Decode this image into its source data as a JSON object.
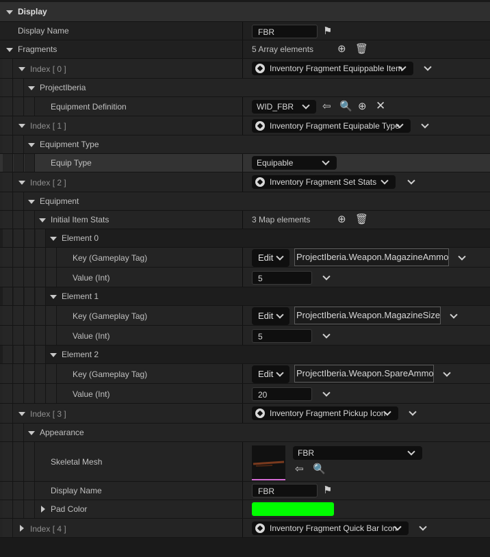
{
  "section": {
    "title": "Display"
  },
  "display_name": {
    "label": "Display Name",
    "value": "FBR"
  },
  "fragments": {
    "label": "Fragments",
    "count": "5 Array elements"
  },
  "index0": {
    "label": "Index [ 0 ]",
    "type": "Inventory Fragment Equippable Item",
    "category": "ProjectIberia",
    "equip_def_label": "Equipment Definition",
    "equip_def_value": "WID_FBR"
  },
  "index1": {
    "label": "Index [ 1 ]",
    "type": "Inventory Fragment Equipable Type",
    "category": "Equipment Type",
    "equip_type_label": "Equip Type",
    "equip_type_value": "Equipable"
  },
  "index2": {
    "label": "Index [ 2 ]",
    "type": "Inventory Fragment Set Stats",
    "category": "Equipment",
    "stats_label": "Initial Item Stats",
    "stats_count": "3 Map elements",
    "elements": [
      {
        "label": "Element 0",
        "key_label": "Key (Gameplay Tag)",
        "edit": "Edit",
        "tag": "ProjectIberia.Weapon.MagazineAmmo",
        "value_label": "Value (Int)",
        "value": "5"
      },
      {
        "label": "Element 1",
        "key_label": "Key (Gameplay Tag)",
        "edit": "Edit",
        "tag": "ProjectIberia.Weapon.MagazineSize",
        "value_label": "Value (Int)",
        "value": "5"
      },
      {
        "label": "Element 2",
        "key_label": "Key (Gameplay Tag)",
        "edit": "Edit",
        "tag": "ProjectIberia.Weapon.SpareAmmo",
        "value_label": "Value (Int)",
        "value": "20"
      }
    ]
  },
  "index3": {
    "label": "Index [ 3 ]",
    "type": "Inventory Fragment Pickup Icon",
    "category": "Appearance",
    "mesh_label": "Skeletal Mesh",
    "mesh_value": "FBR",
    "display_name_label": "Display Name",
    "display_name_value": "FBR",
    "pad_color_label": "Pad Color",
    "pad_color": "#00ff00"
  },
  "index4": {
    "label": "Index [ 4 ]",
    "type": "Inventory Fragment Quick Bar Icon"
  }
}
